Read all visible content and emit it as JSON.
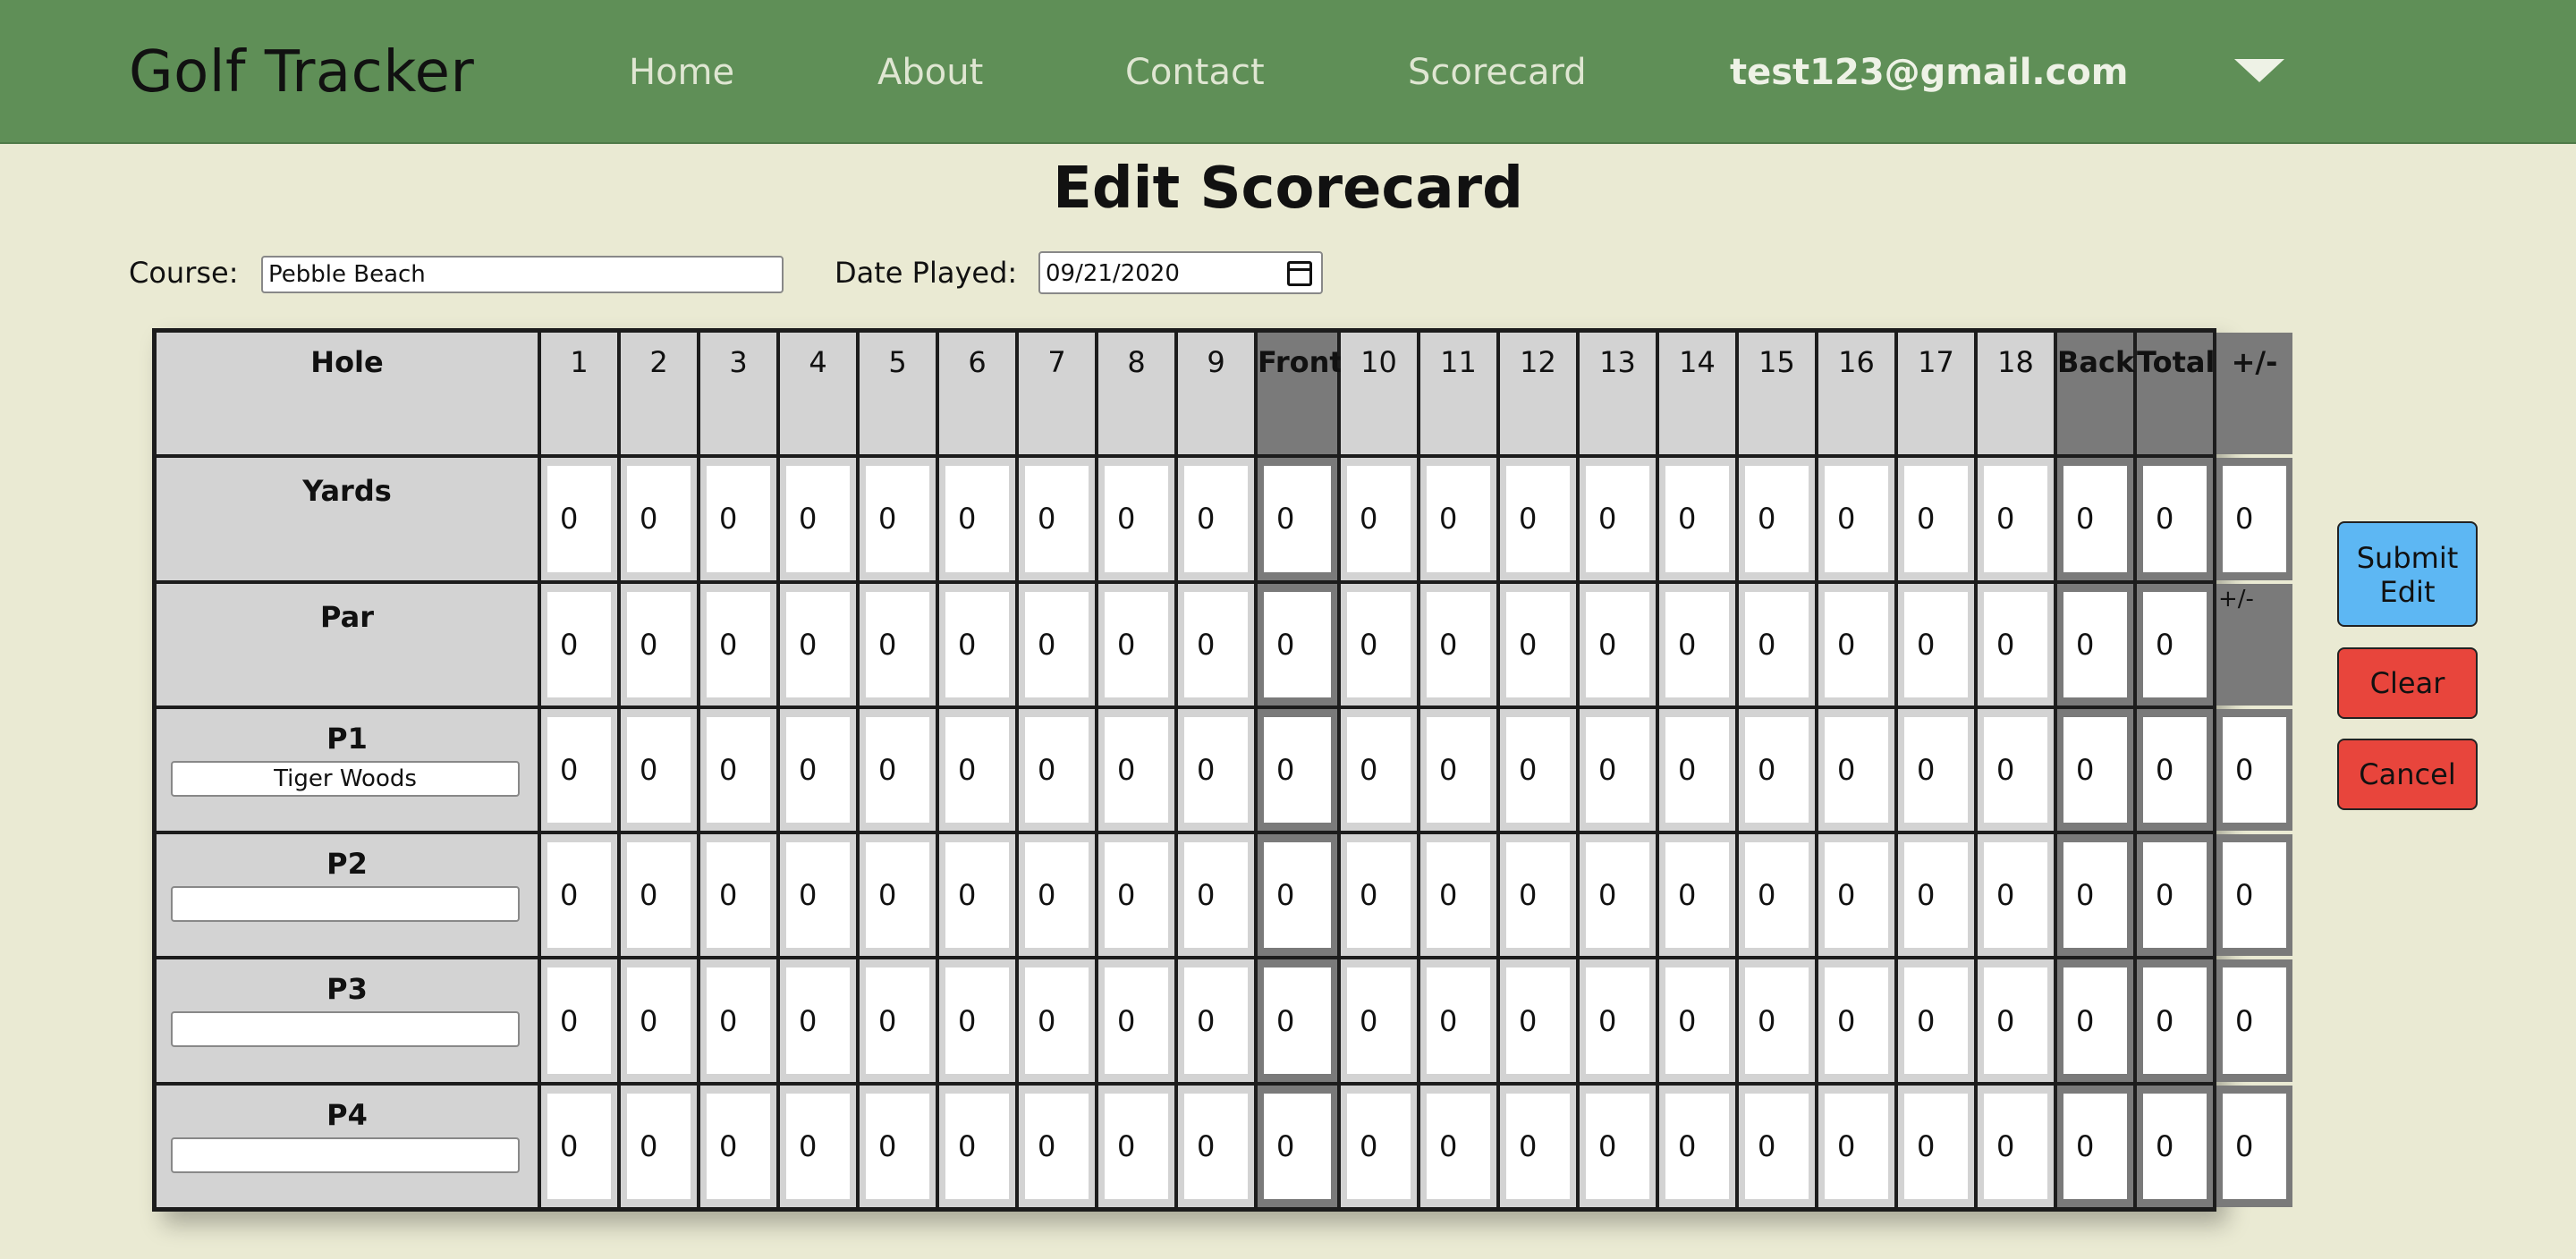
{
  "nav": {
    "brand": "Golf Tracker",
    "links": [
      "Home",
      "About",
      "Contact",
      "Scorecard"
    ],
    "user_email": "test123@gmail.com"
  },
  "page_title": "Edit Scorecard",
  "form": {
    "course_label": "Course:",
    "course_value": "Pebble Beach",
    "date_label": "Date Played:",
    "date_value": "09/21/2020"
  },
  "scorecard": {
    "columns": [
      "Hole",
      "1",
      "2",
      "3",
      "4",
      "5",
      "6",
      "7",
      "8",
      "9",
      "Front",
      "10",
      "11",
      "12",
      "13",
      "14",
      "15",
      "16",
      "17",
      "18",
      "Back",
      "Total",
      "+/-"
    ],
    "rows": [
      {
        "label": "Yards",
        "values": [
          "0",
          "0",
          "0",
          "0",
          "0",
          "0",
          "0",
          "0",
          "0",
          "0",
          "0",
          "0",
          "0",
          "0",
          "0",
          "0",
          "0",
          "0",
          "0",
          "0",
          "0",
          "0"
        ]
      },
      {
        "label": "Par",
        "values": [
          "0",
          "0",
          "0",
          "0",
          "0",
          "0",
          "0",
          "0",
          "0",
          "0",
          "0",
          "0",
          "0",
          "0",
          "0",
          "0",
          "0",
          "0",
          "0",
          "0",
          "0",
          "+/-"
        ]
      },
      {
        "label": "P1",
        "player_name": "Tiger Woods",
        "values": [
          "0",
          "0",
          "0",
          "0",
          "0",
          "0",
          "0",
          "0",
          "0",
          "0",
          "0",
          "0",
          "0",
          "0",
          "0",
          "0",
          "0",
          "0",
          "0",
          "0",
          "0",
          "0"
        ]
      },
      {
        "label": "P2",
        "player_name": "",
        "values": [
          "0",
          "0",
          "0",
          "0",
          "0",
          "0",
          "0",
          "0",
          "0",
          "0",
          "0",
          "0",
          "0",
          "0",
          "0",
          "0",
          "0",
          "0",
          "0",
          "0",
          "0",
          "0"
        ]
      },
      {
        "label": "P3",
        "player_name": "",
        "values": [
          "0",
          "0",
          "0",
          "0",
          "0",
          "0",
          "0",
          "0",
          "0",
          "0",
          "0",
          "0",
          "0",
          "0",
          "0",
          "0",
          "0",
          "0",
          "0",
          "0",
          "0",
          "0"
        ]
      },
      {
        "label": "P4",
        "player_name": "",
        "values": [
          "0",
          "0",
          "0",
          "0",
          "0",
          "0",
          "0",
          "0",
          "0",
          "0",
          "0",
          "0",
          "0",
          "0",
          "0",
          "0",
          "0",
          "0",
          "0",
          "0",
          "0",
          "0"
        ]
      }
    ]
  },
  "buttons": {
    "submit": "Submit Edit",
    "clear": "Clear",
    "cancel": "Cancel"
  },
  "colors": {
    "navbar": "#5f8f57",
    "background": "#eaead3",
    "cell_light": "#d3d3d3",
    "cell_dark": "#7a7a7a",
    "submit": "#5db7f3",
    "danger": "#e8453c"
  }
}
